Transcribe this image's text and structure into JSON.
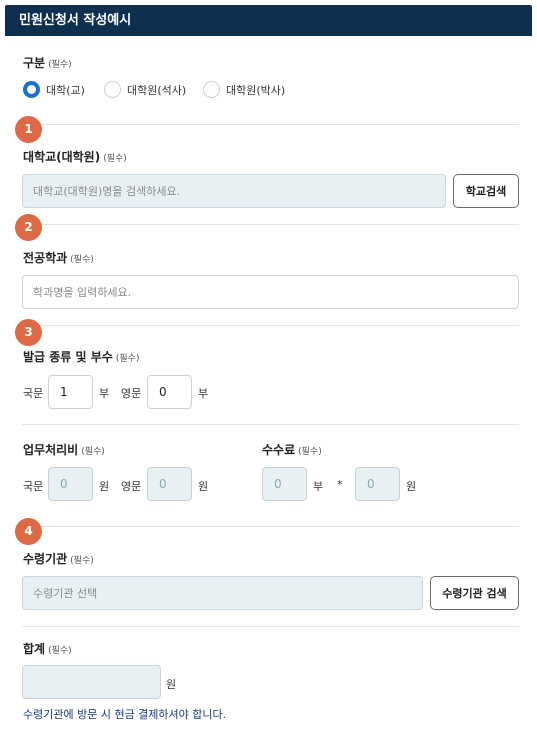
{
  "header": {
    "title": "민원신청서 작성예시"
  },
  "category": {
    "label": "구분",
    "required": "(필수)",
    "options": [
      "대학(교)",
      "대학원(석사)",
      "대학원(박사)"
    ],
    "selected": "대학(교)"
  },
  "steps": [
    "1",
    "2",
    "3",
    "4"
  ],
  "university": {
    "label": "대학교(대학원)",
    "required": "(필수)",
    "placeholder": "대학교(대학원)명을 검색하세요.",
    "button": "학교검색"
  },
  "major": {
    "label": "전공학과",
    "required": "(필수)",
    "placeholder": "학과명을 입력하세요."
  },
  "issue": {
    "label": "발급 종류 및 부수",
    "required": "(필수)",
    "korean_label": "국문",
    "korean_value": "1",
    "unit_copies": "부",
    "english_label": "영문",
    "english_value": "0"
  },
  "processing_fee": {
    "label": "업무처리비",
    "required": "(필수)",
    "korean_label": "국문",
    "korean_value": "0",
    "unit_won": "원",
    "english_label": "영문",
    "english_value": "0"
  },
  "fee": {
    "label": "수수료",
    "required": "(필수)",
    "copies_value": "0",
    "unit_copies": "부",
    "multiply": "*",
    "amount_value": "0",
    "unit_won": "원"
  },
  "receiving_agency": {
    "label": "수령기관",
    "required": "(필수)",
    "placeholder": "수령기관 선택",
    "button": "수령기관 검색"
  },
  "total": {
    "label": "합계",
    "required": "(필수)",
    "unit_won": "원",
    "note": "수령기관에 방문 시 현금 결제하셔야 합니다."
  }
}
